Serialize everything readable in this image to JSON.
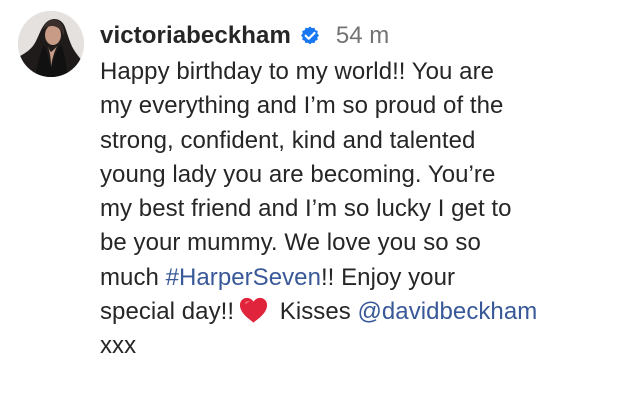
{
  "post": {
    "username": "victoriabeckham",
    "timestamp": "54 m",
    "icons": {
      "avatar": "profile-avatar",
      "verified": "verified-badge-icon",
      "heart": "red-heart-icon"
    },
    "colors": {
      "username": "#262626",
      "timestamp": "#737373",
      "link": "#385898",
      "verified": "#1877f2",
      "heart": "#e0243b"
    },
    "caption": {
      "line1": "Happy birthday to my world!! You are",
      "line2": "my everything and I’m so proud of the",
      "line3": "strong, confident, kind and talented",
      "line4": "young lady you are becoming. You’re",
      "line5": "my best friend and I’m so lucky I get to",
      "line6": "be your mummy. We love you so so",
      "line7_before_hashtag": "much ",
      "hashtag": "#HarperSeven",
      "line7_after_hashtag": "!! Enjoy your",
      "line8_before_heart": "special day!!",
      "line8_after_heart": " Kisses ",
      "mention": "@davidbeckham",
      "line9": "xxx"
    }
  }
}
